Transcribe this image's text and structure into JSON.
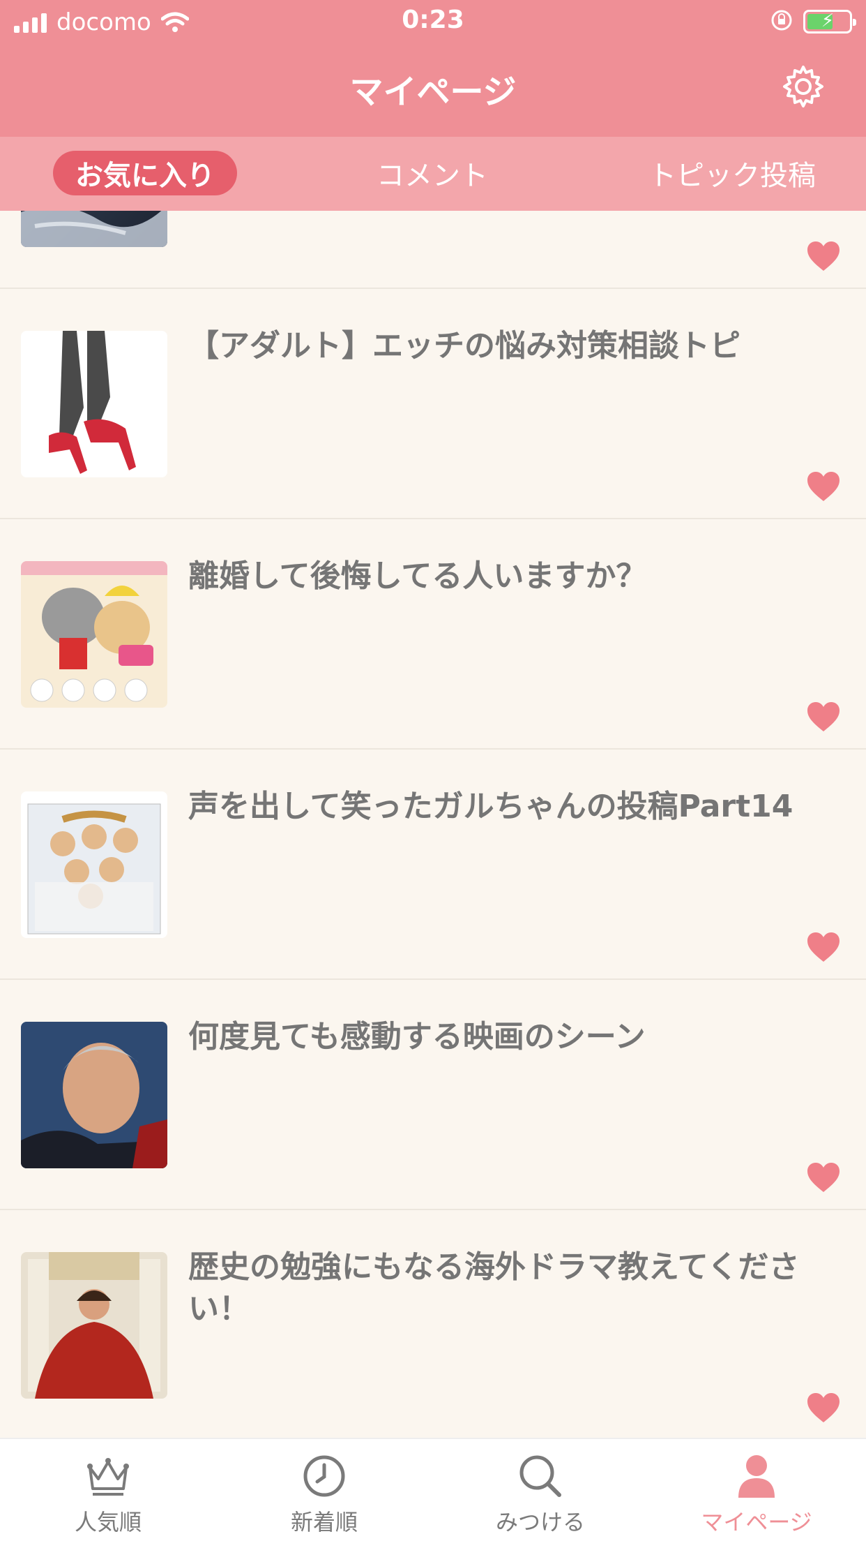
{
  "status_bar": {
    "carrier": "docomo",
    "time": "0:23"
  },
  "nav": {
    "title": "マイページ",
    "settings_icon": "gear-icon"
  },
  "tabs": [
    {
      "label": "お気に入り",
      "active": true
    },
    {
      "label": "コメント",
      "active": false
    },
    {
      "label": "トピック投稿",
      "active": false
    }
  ],
  "topics": [
    {
      "title": "",
      "favorited": true,
      "thumb": "earth-photo"
    },
    {
      "title": "【アダルト】エッチの悩み対策相談トピ",
      "favorited": true,
      "thumb": "red-heels-photo"
    },
    {
      "title": "離婚して後悔してる人いますか？",
      "favorited": true,
      "thumb": "cats-poster"
    },
    {
      "title": "声を出して笑ったガルちゃんの投稿Part14",
      "favorited": true,
      "thumb": "group-photo"
    },
    {
      "title": "何度見ても感動する映画のシーン",
      "favorited": true,
      "thumb": "man-portrait"
    },
    {
      "title": "歴史の勉強にもなる海外ドラマ教えてください！",
      "favorited": true,
      "thumb": "queen-dress-photo"
    }
  ],
  "bottom_nav": [
    {
      "label": "人気順",
      "icon": "crown-icon",
      "active": false
    },
    {
      "label": "新着順",
      "icon": "clock-icon",
      "active": false
    },
    {
      "label": "みつける",
      "icon": "search-icon",
      "active": false
    },
    {
      "label": "マイページ",
      "icon": "user-icon",
      "active": true
    }
  ],
  "colors": {
    "header": "#ef8f96",
    "tab_strip": "#f3a6ab",
    "tab_active": "#e65f6c",
    "heart": "#ef7f88",
    "background": "#fbf6ef"
  }
}
